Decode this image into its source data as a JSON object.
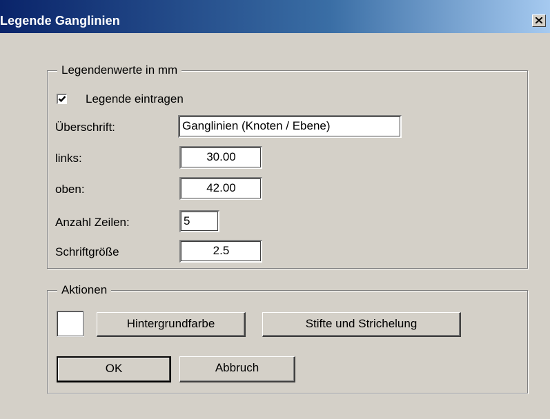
{
  "window": {
    "title": "Legende Ganglinien"
  },
  "legend_group": {
    "title": "Legendenwerte in mm",
    "checkbox_label": "Legende eintragen",
    "checkbox_checked": true,
    "heading_label": "Überschrift:",
    "heading_value": "Ganglinien (Knoten / Ebene)",
    "left_label": "links:",
    "left_value": "30.00",
    "top_label": "oben:",
    "top_value": "42.00",
    "rows_label": "Anzahl Zeilen:",
    "rows_value": "5",
    "fontsize_label": "Schriftgröße",
    "fontsize_value": "2.5"
  },
  "actions_group": {
    "title": "Aktionen",
    "background_color": "#ffffff",
    "background_button": "Hintergrundfarbe",
    "pens_button": "Stifte und Strichelung"
  },
  "footer": {
    "ok_label": "OK",
    "cancel_label": "Abbruch"
  },
  "icons": {
    "close": "close-icon",
    "check": "checkmark-icon"
  }
}
